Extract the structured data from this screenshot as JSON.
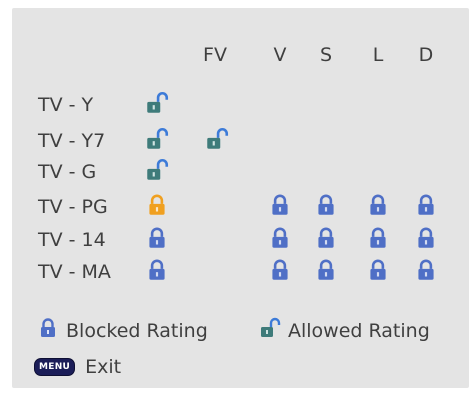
{
  "columns": [
    "FV",
    "V",
    "S",
    "L",
    "D"
  ],
  "rows": [
    {
      "label": "TV - Y",
      "cells": [
        "allowed",
        "",
        "",
        "",
        "",
        ""
      ]
    },
    {
      "label": "TV - Y7",
      "cells": [
        "allowed",
        "allowed",
        "",
        "",
        "",
        ""
      ]
    },
    {
      "label": "TV - G",
      "cells": [
        "allowed",
        "",
        "",
        "",
        "",
        ""
      ]
    },
    {
      "label": "TV - PG",
      "cells": [
        "blocked-selected",
        "",
        "blocked",
        "blocked",
        "blocked",
        "blocked"
      ]
    },
    {
      "label": "TV - 14",
      "cells": [
        "blocked",
        "",
        "blocked",
        "blocked",
        "blocked",
        "blocked"
      ]
    },
    {
      "label": "TV - MA",
      "cells": [
        "blocked",
        "",
        "blocked",
        "blocked",
        "blocked",
        "blocked"
      ]
    }
  ],
  "legend": {
    "blocked_label": "Blocked Rating",
    "allowed_label": "Allowed Rating",
    "blocked_icon": "locked-padlock-icon",
    "allowed_icon": "unlocked-padlock-icon"
  },
  "footer": {
    "menu_key": "MENU",
    "exit_label": "Exit"
  },
  "colors": {
    "background": "#e4e4e4",
    "lock_blue": "#4f6fc6",
    "lock_orange": "#f0a020",
    "unlock_shackle": "#3d7bd8",
    "unlock_body": "#3e7b7a"
  }
}
